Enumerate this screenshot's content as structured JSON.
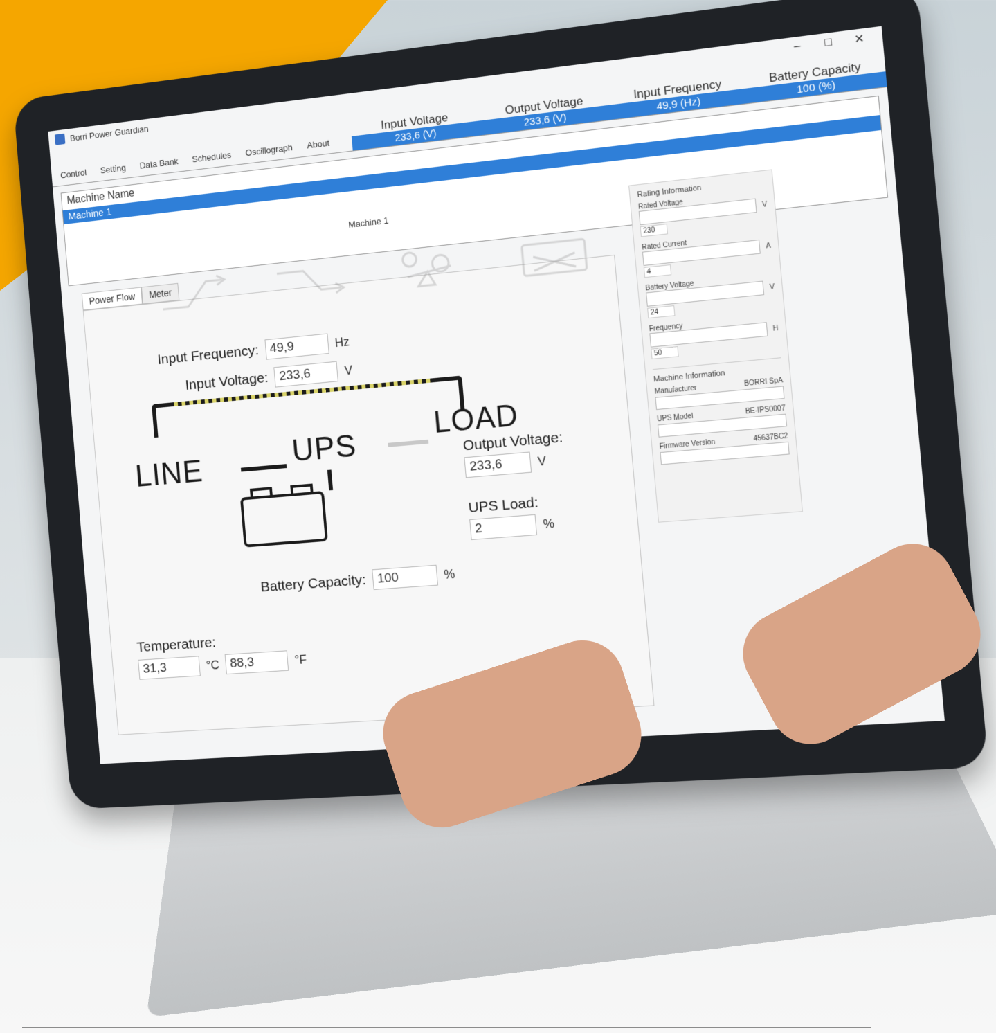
{
  "window": {
    "title": "Borri Power Guardian",
    "controls": [
      "–",
      "□",
      "✕"
    ]
  },
  "menu": [
    "Control",
    "Setting",
    "Data Bank",
    "Schedules",
    "Oscillograph",
    "About"
  ],
  "metrics": [
    {
      "label": "Input Voltage",
      "value": "233,6 (V)"
    },
    {
      "label": "Output Voltage",
      "value": "233,6 (V)"
    },
    {
      "label": "Input Frequency",
      "value": "49,9 (Hz)"
    },
    {
      "label": "Battery Capacity",
      "value": "100 (%)"
    }
  ],
  "machine_list": {
    "header": "Machine Name",
    "selected": "Machine 1"
  },
  "machine_title": "Machine 1",
  "tabs": [
    "Power Flow",
    "Meter"
  ],
  "power_flow": {
    "input_frequency": {
      "label": "Input Frequency:",
      "value": "49,9",
      "unit": "Hz"
    },
    "input_voltage": {
      "label": "Input Voltage:",
      "value": "233,6",
      "unit": "V"
    },
    "line": "LINE",
    "ups": "UPS",
    "load": "LOAD",
    "output_voltage": {
      "label": "Output Voltage:",
      "value": "233,6",
      "unit": "V"
    },
    "ups_load": {
      "label": "UPS Load:",
      "value": "2",
      "unit": "%"
    },
    "battery_capacity": {
      "label": "Battery Capacity:",
      "value": "100",
      "unit": "%"
    },
    "temperature": {
      "label": "Temperature:",
      "celsius": "31,3",
      "celsius_unit": "°C",
      "fahrenheit": "88,3",
      "fahrenheit_unit": "°F"
    }
  },
  "rating": {
    "title": "Rating Information",
    "fields": [
      {
        "label": "Rated Voltage",
        "unit": "V",
        "value": "230"
      },
      {
        "label": "Rated Current",
        "unit": "A",
        "value": "4"
      },
      {
        "label": "Battery Voltage",
        "unit": "V",
        "value": "24"
      },
      {
        "label": "Frequency",
        "unit": "H",
        "value": "50"
      }
    ]
  },
  "machine_info": {
    "title": "Machine Information",
    "manufacturer": {
      "label": "Manufacturer",
      "value": "BORRI SpA"
    },
    "ups_model": {
      "label": "UPS Model",
      "value": "BE-IPS0007"
    },
    "firmware": {
      "label": "Firmware Version",
      "value": "45637BC2"
    }
  },
  "colors": {
    "accent": "#f5a600",
    "selection": "#2f7fd8"
  }
}
